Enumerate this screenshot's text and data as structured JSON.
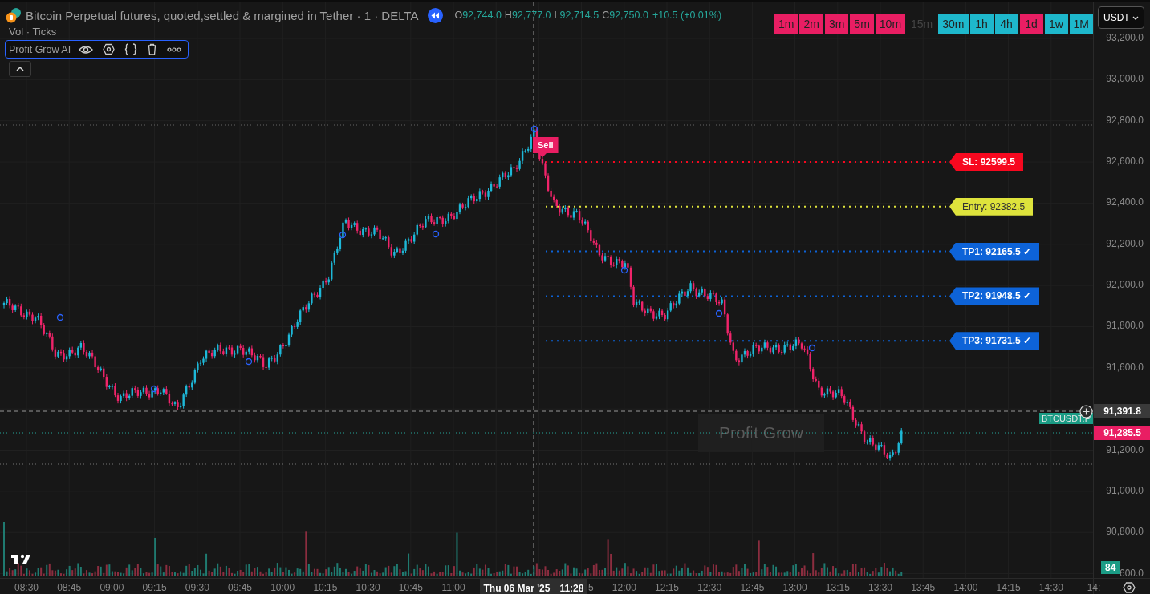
{
  "header": {
    "title": "Bitcoin Perpetual futures, quoted,settled & margined in Tether · 1 · DELTA",
    "ohlc": [
      {
        "label": "O",
        "value": "92,744.0"
      },
      {
        "label": "H",
        "value": "92,777.0"
      },
      {
        "label": "L",
        "value": "92,714.5"
      },
      {
        "label": "C",
        "value": "92,750.0"
      }
    ],
    "change": "+10.5 (+0.01%)",
    "subtitle": "Vol · Ticks",
    "indicator": {
      "name": "Profit Grow AI"
    }
  },
  "timeframes": [
    {
      "label": "1m",
      "color": "#e91e63",
      "disabled": false
    },
    {
      "label": "2m",
      "color": "#e91e63",
      "disabled": false
    },
    {
      "label": "3m",
      "color": "#e91e63",
      "disabled": false
    },
    {
      "label": "5m",
      "color": "#e91e63",
      "disabled": false
    },
    {
      "label": "10m",
      "color": "#e91e63",
      "disabled": false
    },
    {
      "label": "15m",
      "disabled": true
    },
    {
      "label": "30m",
      "color": "#1eb8cc",
      "disabled": false
    },
    {
      "label": "1h",
      "color": "#1eb8cc",
      "disabled": false
    },
    {
      "label": "4h",
      "color": "#1eb8cc",
      "disabled": false
    },
    {
      "label": "1d",
      "color": "#e91e63",
      "disabled": false
    },
    {
      "label": "1w",
      "color": "#1eb8cc",
      "disabled": false
    },
    {
      "label": "1M",
      "color": "#1eb8cc",
      "disabled": false
    }
  ],
  "currency": {
    "value": "USDT"
  },
  "overlay_box": {
    "text": "Profit Grow"
  },
  "signal": {
    "label": "Sell"
  },
  "levels": [
    {
      "label": "SL: 92599.5",
      "color": "#f7081f"
    },
    {
      "label": "Entry: 92382.5",
      "color": "#dee33c"
    },
    {
      "label": "TP1: 92165.5 ✓",
      "color": "#0d63d8"
    },
    {
      "label": "TP2: 91948.5 ✓",
      "color": "#0d63d8"
    },
    {
      "label": "TP3: 91731.5 ✓",
      "color": "#0d63d8"
    }
  ],
  "price_axis": {
    "labels": [
      "93,200.0",
      "93,000.0",
      "92,800.0",
      "92,600.0",
      "92,400.0",
      "92,200.0",
      "92,000.0",
      "91,800.0",
      "91,600.0",
      "91,200.0",
      "91,000.0",
      "90,800.0",
      "600.0"
    ]
  },
  "price_badges": [
    {
      "kind": "crosshair",
      "value": "91,391.8"
    },
    {
      "kind": "last",
      "value": "91,285.5"
    }
  ],
  "symbol_tag": "BTCUSDT.P",
  "volume_badge": "84",
  "time_axis": {
    "labels": [
      {
        "text": "08:30",
        "cut": false
      },
      {
        "text": "08:45",
        "cut": false
      },
      {
        "text": "09:00",
        "cut": false
      },
      {
        "text": "09:15",
        "cut": false
      },
      {
        "text": "09:30",
        "cut": false
      },
      {
        "text": "09:45",
        "cut": false
      },
      {
        "text": "10:00",
        "cut": false
      },
      {
        "text": "10:15",
        "cut": false
      },
      {
        "text": "10:30",
        "cut": false
      },
      {
        "text": "10:45",
        "cut": false
      },
      {
        "text": "11:00",
        "cut": false
      },
      {
        "text": "5",
        "cut": true
      },
      {
        "text": "12:00",
        "cut": false
      },
      {
        "text": "12:15",
        "cut": false
      },
      {
        "text": "12:30",
        "cut": false
      },
      {
        "text": "12:45",
        "cut": false
      },
      {
        "text": "13:00",
        "cut": false
      },
      {
        "text": "13:15",
        "cut": false
      },
      {
        "text": "13:30",
        "cut": false
      },
      {
        "text": "13:45",
        "cut": false
      },
      {
        "text": "14:00",
        "cut": false
      },
      {
        "text": "14:15",
        "cut": false
      },
      {
        "text": "14:30",
        "cut": false
      },
      {
        "text": "14:",
        "cut": false
      }
    ],
    "crosshair": {
      "date": "Thu 06 Mar '25",
      "time": "11:28"
    }
  }
}
